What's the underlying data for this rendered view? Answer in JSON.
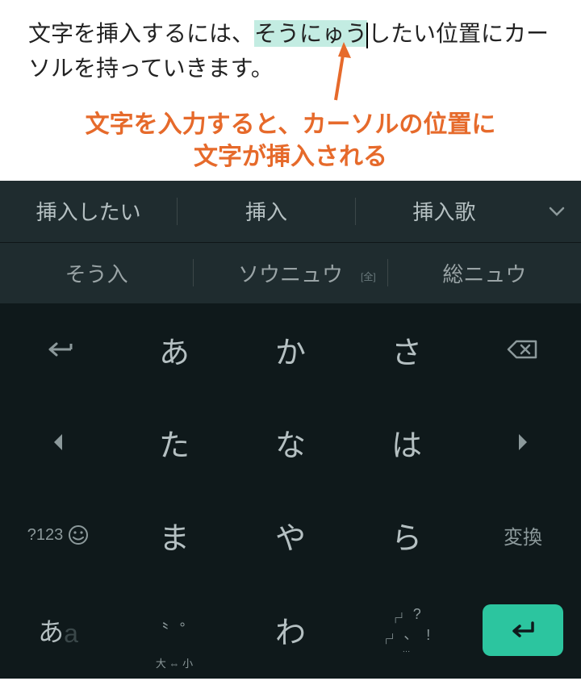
{
  "text": {
    "before": "文字を挿入するには、",
    "highlighted": "そうにゅう",
    "after": "したい位置にカーソルを持っていきます。"
  },
  "annotation": {
    "line1": "文字を入力すると、カーソルの位置に",
    "line2": "文字が挿入される"
  },
  "suggestions": {
    "row1": [
      "挿入したい",
      "挿入",
      "挿入歌"
    ],
    "row2": [
      "そう入",
      "ソウニュウ",
      "総ニュウ"
    ],
    "badge": "[全]"
  },
  "keys": {
    "r1": {
      "a": "あ",
      "ka": "か",
      "sa": "さ"
    },
    "r2": {
      "ta": "た",
      "na": "な",
      "ha": "は"
    },
    "r3": {
      "num": "?123",
      "ma": "ま",
      "ya": "や",
      "ra": "ら",
      "henkan": "変換"
    },
    "r4": {
      "lang_jp": "あ",
      "lang_en": "a",
      "dakuten_left": "〝",
      "dakuten_right": "゜",
      "dakuten_sub": "大 ⇔ 小",
      "wa": "わ",
      "sym_q": "?",
      "sym_dot": "、",
      "sym_ex": "!",
      "sym_more": "…"
    }
  }
}
